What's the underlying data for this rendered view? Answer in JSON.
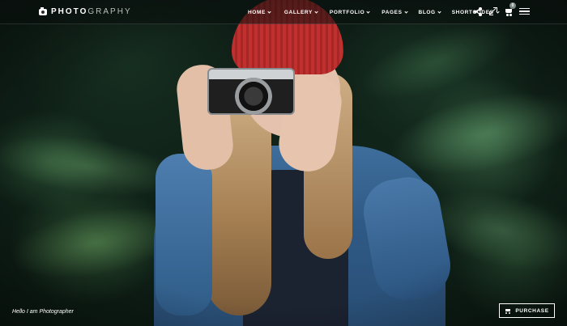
{
  "header": {
    "logo_bold": "PHOTO",
    "logo_light": "GRAPHY",
    "nav": [
      {
        "label": "HOME"
      },
      {
        "label": "GALLERY"
      },
      {
        "label": "PORTFOLIO"
      },
      {
        "label": "PAGES"
      },
      {
        "label": "BLOG"
      },
      {
        "label": "SHORTCODES"
      }
    ],
    "cart_count": "0",
    "icons": [
      "camera-logo-icon",
      "share-icon",
      "fullscreen-icon",
      "cart-icon",
      "menu-icon"
    ]
  },
  "hero": {
    "caption": "Hello I am Photographer"
  },
  "purchase": {
    "label": "PURCHASE"
  },
  "colors": {
    "header_bg": "#0a0e0c",
    "text": "#ffffff",
    "hat": "#c0302f",
    "jacket": "#3f6e9c"
  }
}
